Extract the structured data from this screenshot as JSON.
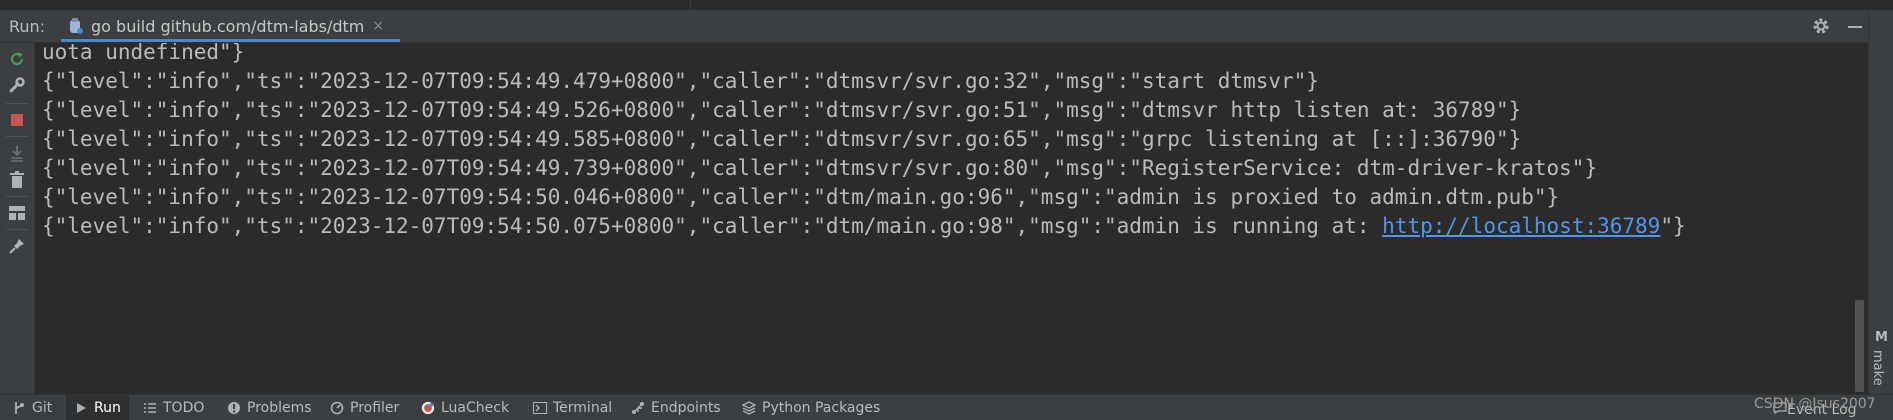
{
  "run_header": {
    "run_label": "Run:",
    "tab_label": "go build github.com/dtm-labs/dtm",
    "tab_close": "×"
  },
  "console": {
    "lines": [
      "uota undefined\"}",
      "{\"level\":\"info\",\"ts\":\"2023-12-07T09:54:49.479+0800\",\"caller\":\"dtmsvr/svr.go:32\",\"msg\":\"start dtmsvr\"}",
      "{\"level\":\"info\",\"ts\":\"2023-12-07T09:54:49.526+0800\",\"caller\":\"dtmsvr/svr.go:51\",\"msg\":\"dtmsvr http listen at: 36789\"}",
      "{\"level\":\"info\",\"ts\":\"2023-12-07T09:54:49.585+0800\",\"caller\":\"dtmsvr/svr.go:65\",\"msg\":\"grpc listening at [::]:36790\"}",
      "{\"level\":\"info\",\"ts\":\"2023-12-07T09:54:49.739+0800\",\"caller\":\"dtmsvr/svr.go:80\",\"msg\":\"RegisterService: dtm-driver-kratos\"}",
      "{\"level\":\"info\",\"ts\":\"2023-12-07T09:54:50.046+0800\",\"caller\":\"dtm/main.go:96\",\"msg\":\"admin is proxied to admin.dtm.pub\"}"
    ],
    "last_line_prefix": "{\"level\":\"info\",\"ts\":\"2023-12-07T09:54:50.075+0800\",\"caller\":\"dtm/main.go:98\",\"msg\":\"admin is running at: ",
    "last_line_link": "http://localhost:36789",
    "last_line_suffix": "\"}"
  },
  "right_strip": {
    "make_icon": "M",
    "make_label": "make"
  },
  "bottom_bar": {
    "tabs": [
      {
        "label": "Git",
        "icon": "git-branch-icon"
      },
      {
        "label": "Run",
        "icon": "run-icon"
      },
      {
        "label": "TODO",
        "icon": "todo-list-icon"
      },
      {
        "label": "Problems",
        "icon": "problems-icon"
      },
      {
        "label": "Profiler",
        "icon": "profiler-icon"
      },
      {
        "label": "LuaCheck",
        "icon": "luacheck-icon"
      },
      {
        "label": "Terminal",
        "icon": "terminal-icon"
      },
      {
        "label": "Endpoints",
        "icon": "endpoints-icon"
      },
      {
        "label": "Python Packages",
        "icon": "python-packages-icon"
      }
    ],
    "event_log": "Event Log",
    "watermark": "CSDN @Jsus2007"
  },
  "colors": {
    "background": "#2b2b2b",
    "panel": "#3c3f41",
    "text": "#bbbbbb",
    "link": "#5394ec",
    "tab_underline": "#4a88c7",
    "rerun_green": "#499c54",
    "stop_red": "#c75450"
  }
}
